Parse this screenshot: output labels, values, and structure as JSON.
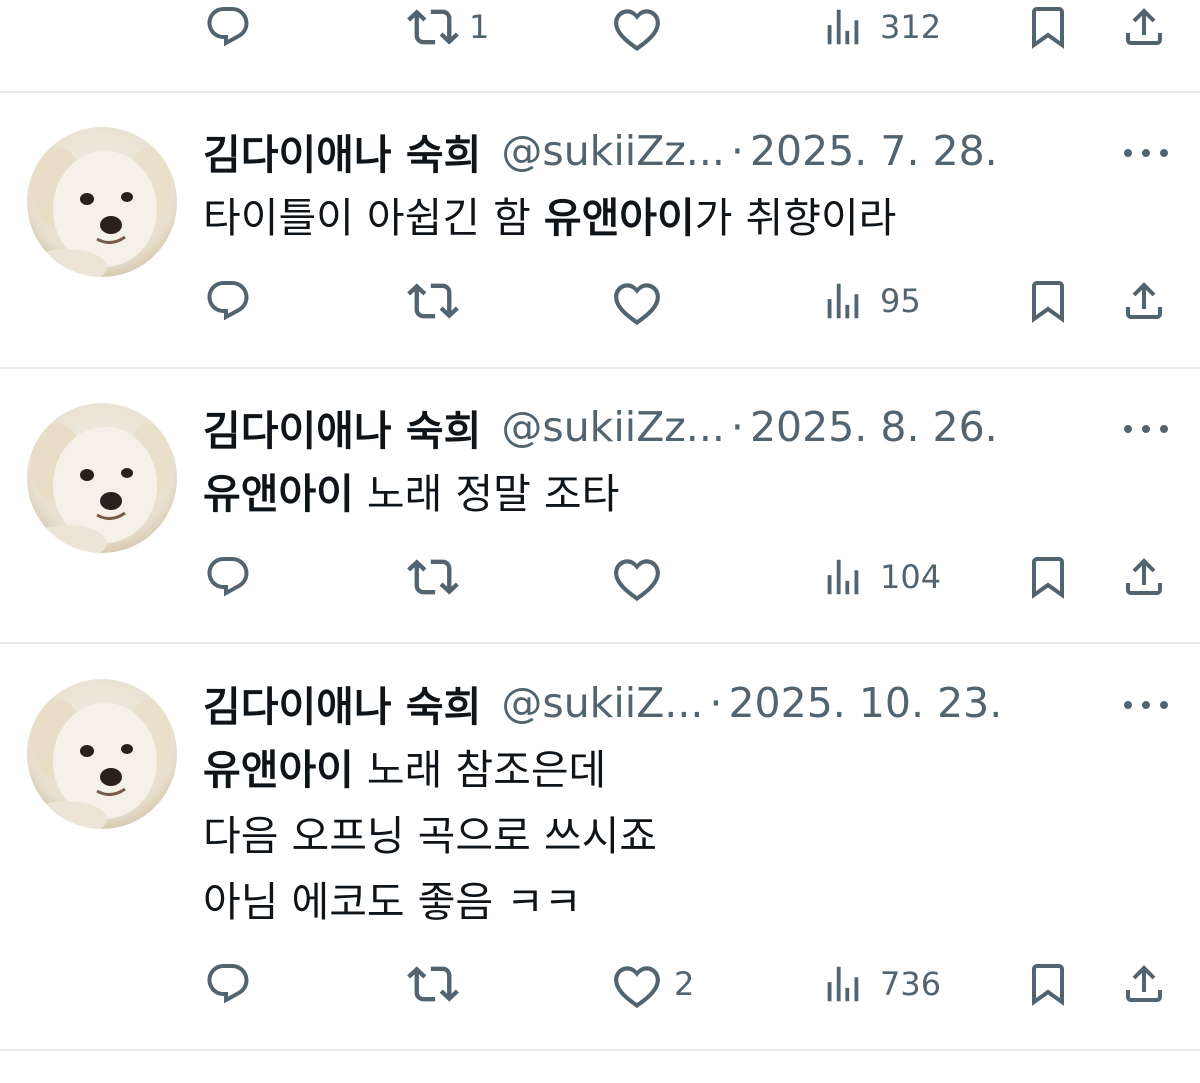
{
  "top_actions": {
    "retweets": "1",
    "views": "312"
  },
  "posts": [
    {
      "display_name": "김다이애나 숙희",
      "handle": "@sukiiZz...",
      "separator": "·",
      "date": "2025. 7. 28.",
      "lines": [
        [
          {
            "t": "타이틀이 아쉽긴 함 ",
            "b": false
          },
          {
            "t": "유앤아이",
            "b": true
          },
          {
            "t": "가 취향이라",
            "b": false
          }
        ]
      ],
      "replies": "",
      "retweets": "",
      "likes": "",
      "views": "95"
    },
    {
      "display_name": "김다이애나 숙희",
      "handle": "@sukiiZz...",
      "separator": "·",
      "date": "2025. 8. 26.",
      "lines": [
        [
          {
            "t": "유앤아이",
            "b": true
          },
          {
            "t": " 노래 정말 조타",
            "b": false
          }
        ]
      ],
      "replies": "",
      "retweets": "",
      "likes": "",
      "views": "104"
    },
    {
      "display_name": "김다이애나 숙희",
      "handle": "@sukiiZ...",
      "separator": "·",
      "date": "2025. 10. 23.",
      "lines": [
        [
          {
            "t": "유앤아이",
            "b": true
          },
          {
            "t": " 노래 참조은데",
            "b": false
          }
        ],
        [
          {
            "t": "다음 오프닝 곡으로 쓰시죠",
            "b": false
          }
        ],
        [
          {
            "t": "아님 에코도 좋음 ㅋㅋ",
            "b": false
          }
        ]
      ],
      "replies": "",
      "retweets": "",
      "likes": "2",
      "views": "736"
    }
  ],
  "colors": {
    "text": "#0f1419",
    "secondary": "#536471",
    "divider": "#e6e9ec"
  },
  "icons": [
    "reply-icon",
    "retweet-icon",
    "like-icon",
    "views-icon",
    "bookmark-icon",
    "share-icon",
    "more-icon"
  ]
}
